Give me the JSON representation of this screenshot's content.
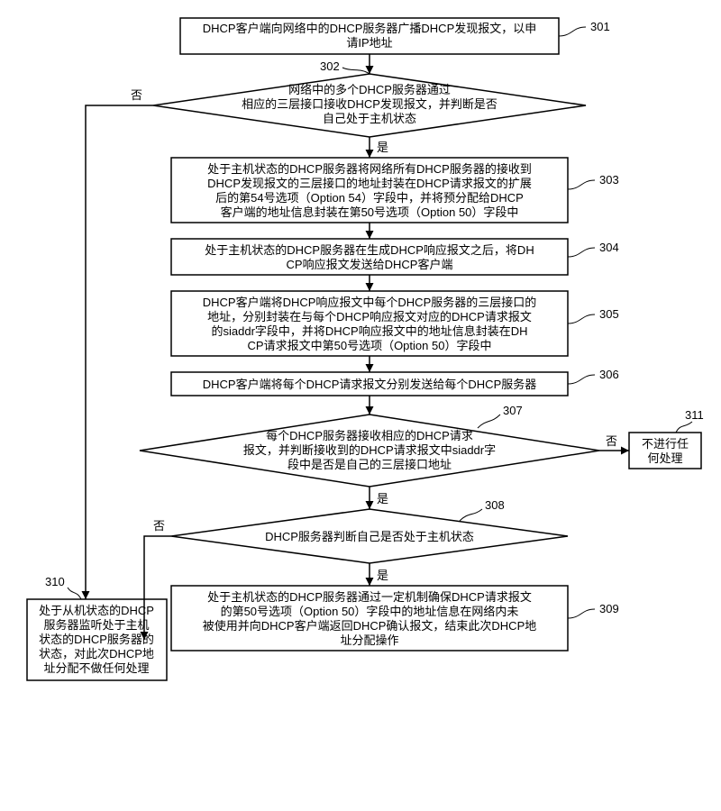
{
  "nodes": {
    "n301": {
      "label": "301",
      "lines": [
        "DHCP客户端向网络中的DHCP服务器广播DHCP发现报文，以申",
        "请IP地址"
      ]
    },
    "n302": {
      "label": "302",
      "lines": [
        "网络中的多个DHCP服务器通过",
        "相应的三层接口接收DHCP发现报文，并判断是否",
        "自己处于主机状态"
      ]
    },
    "n303": {
      "label": "303",
      "lines": [
        "处于主机状态的DHCP服务器将网络所有DHCP服务器的接收到",
        "DHCP发现报文的三层接口的地址封装在DHCP请求报文的扩展",
        "后的第54号选项（Option 54）字段中，并将预分配给DHCP",
        "客户端的地址信息封装在第50号选项（Option 50）字段中"
      ]
    },
    "n304": {
      "label": "304",
      "lines": [
        "处于主机状态的DHCP服务器在生成DHCP响应报文之后，将DH",
        "CP响应报文发送给DHCP客户端"
      ]
    },
    "n305": {
      "label": "305",
      "lines": [
        "DHCP客户端将DHCP响应报文中每个DHCP服务器的三层接口的",
        "地址，分别封装在与每个DHCP响应报文对应的DHCP请求报文",
        "的siaddr字段中，并将DHCP响应报文中的地址信息封装在DH",
        "CP请求报文中第50号选项（Option 50）字段中"
      ]
    },
    "n306": {
      "label": "306",
      "lines": [
        "DHCP客户端将每个DHCP请求报文分别发送给每个DHCP服务器"
      ]
    },
    "n307": {
      "label": "307",
      "lines": [
        "每个DHCP服务器接收相应的DHCP请求",
        "报文，并判断接收到的DHCP请求报文中siaddr字",
        "段中是否是自己的三层接口地址"
      ]
    },
    "n308": {
      "label": "308",
      "lines": [
        "DHCP服务器判断自己是否处于主机状态"
      ]
    },
    "n309": {
      "label": "309",
      "lines": [
        "处于主机状态的DHCP服务器通过一定机制确保DHCP请求报文",
        "的第50号选项（Option 50）字段中的地址信息在网络内未",
        "被使用并向DHCP客户端返回DHCP确认报文，结束此次DHCP地",
        "址分配操作"
      ]
    },
    "n310": {
      "label": "310",
      "lines": [
        "处于从机状态的DHCP",
        "服务器监听处于主机",
        "状态的DHCP服务器的",
        "状态，对此次DHCP地",
        "址分配不做任何处理"
      ]
    },
    "n311": {
      "label": "311",
      "lines": [
        "不进行任",
        "何处理"
      ]
    }
  },
  "edges": {
    "yes": "是",
    "no": "否"
  }
}
